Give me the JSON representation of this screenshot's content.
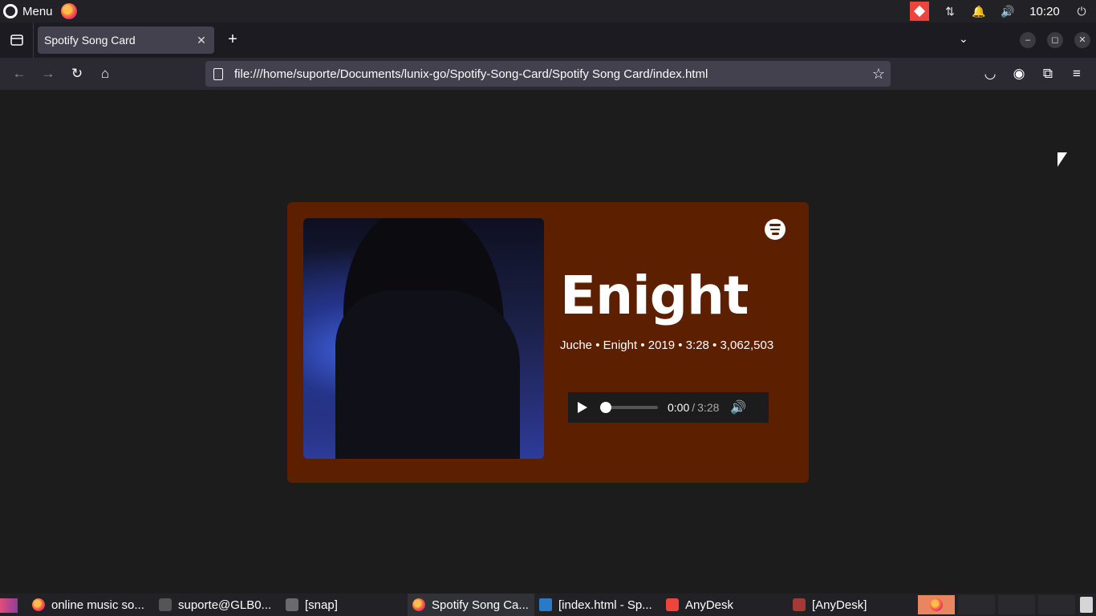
{
  "system_panel": {
    "menu_label": "Menu",
    "clock": "10:20"
  },
  "browser": {
    "tab": {
      "title": "Spotify Song Card",
      "close": "✕"
    },
    "new_tab": "+",
    "url": "file:///home/suporte/Documents/lunix-go/Spotify-Song-Card/Spotify Song Card/index.html",
    "window_controls": {
      "minimize": "–",
      "restore": "◻",
      "close": "✕"
    }
  },
  "song_card": {
    "title": "Enight",
    "meta": "Juche • Enight • 2019 • 3:28 • 3,062,503",
    "player": {
      "current_time": "0:00",
      "separator": "/",
      "duration": "3:28",
      "progress_fraction": 0.0
    },
    "colors": {
      "card_bg": "#5c1f00",
      "page_bg": "#1c1c1c"
    }
  },
  "taskbar": {
    "items": [
      {
        "label": "online music so...",
        "icon": "firefox-icon"
      },
      {
        "label": "suporte@GLB0...",
        "icon": "terminal-icon"
      },
      {
        "label": "[snap]",
        "icon": "folder-icon"
      },
      {
        "label": "Spotify Song Ca...",
        "icon": "firefox-icon"
      },
      {
        "label": "[index.html - Sp...",
        "icon": "vscode-icon"
      },
      {
        "label": "AnyDesk",
        "icon": "anydesk-icon"
      },
      {
        "label": "[AnyDesk]",
        "icon": "anydesk-icon"
      }
    ]
  }
}
